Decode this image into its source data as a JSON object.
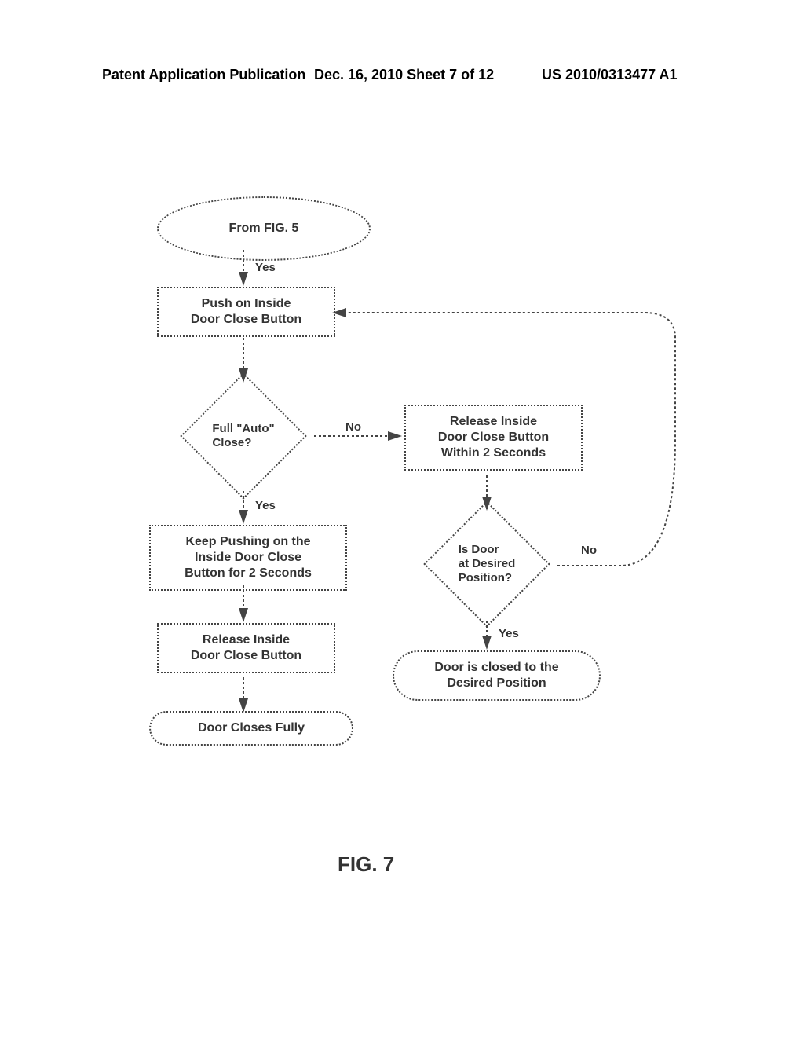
{
  "header": {
    "pub_type": "Patent Application Publication",
    "date_sheet": "Dec. 16, 2010  Sheet 7 of 12",
    "pub_number": "US 2010/0313477 A1"
  },
  "nodes": {
    "start": "From FIG. 5",
    "push": "Push on Inside\nDoor Close Button",
    "auto_decision": "Full \"Auto\"\nClose?",
    "keep_pushing": "Keep Pushing on the\nInside Door Close\nButton for 2 Seconds",
    "release_left": "Release Inside\nDoor Close Button",
    "closes_fully": "Door Closes Fully",
    "release_within": "Release Inside\nDoor Close Button\nWithin 2 Seconds",
    "desired_decision": "Is Door\nat Desired\nPosition?",
    "closed_desired": "Door is closed to the\nDesired Position"
  },
  "edge_labels": {
    "start_push": "Yes",
    "auto_yes": "Yes",
    "auto_no": "No",
    "desired_yes": "Yes",
    "desired_no": "No"
  },
  "figure_label": "FIG. 7"
}
